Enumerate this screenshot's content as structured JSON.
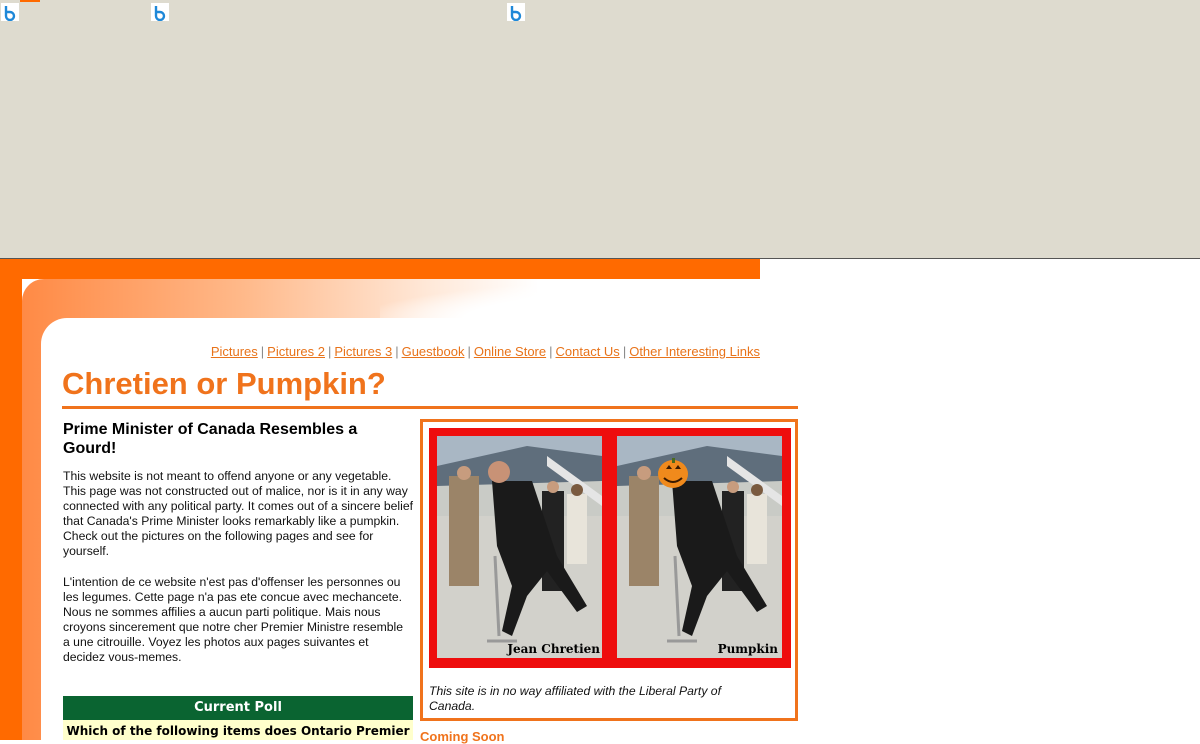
{
  "nav": {
    "links": [
      "Pictures",
      "Pictures 2",
      "Pictures 3",
      "Guestbook",
      "Online Store",
      "Contact Us",
      "Other Interesting Links"
    ],
    "separator": "|"
  },
  "page": {
    "title": "Chretien or Pumpkin?",
    "heading": "Prime Minister of Canada Resembles a Gourd!",
    "paragraph_en": "This website is not meant to offend anyone or any vegetable. This page was not constructed out of malice, nor is it in any way connected with any political party. It comes out of a sincere belief that Canada's Prime Minister looks remarkably like a pumpkin. Check out the pictures on the following pages and see for yourself.",
    "paragraph_fr": "L'intention de ce website n'est pas d'offenser les personnes ou les legumes. Cette page n'a pas ete concue avec mechancete. Nous ne sommes affilies a aucun parti politique. Mais nous croyons sincerement que notre cher Premier Ministre resemble a une citrouille. Voyez les photos aux pages suivantes et decidez vous-memes."
  },
  "photo": {
    "left_label": "Jean Chretien",
    "right_label": "Pumpkin",
    "caption": "This site is in no way affiliated with the Liberal Party of Canada."
  },
  "poll": {
    "header": "Current Poll",
    "question": "Which of the following items does Ontario Premier"
  },
  "coming_soon": "Coming Soon",
  "icons": {
    "ad": "ad-choices-icon"
  },
  "colors": {
    "accent": "#f0731c",
    "frame": "#ff6a00",
    "poll_header": "#0a6431",
    "poll_question_bg": "#ffffcc",
    "photo_frame": "#ee0d0d",
    "ad_background": "#dedbcf"
  }
}
